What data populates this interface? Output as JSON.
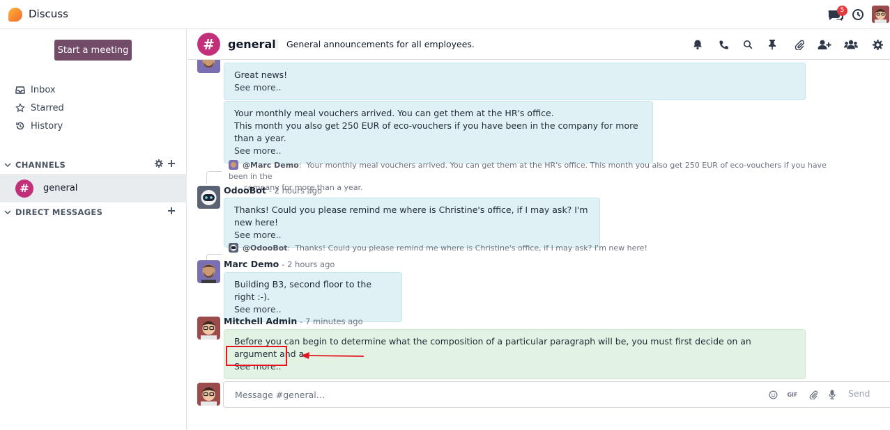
{
  "app": {
    "title": "Discuss",
    "notification_count": "5"
  },
  "sidebar": {
    "start_meeting_label": "Start a meeting",
    "nav": [
      {
        "label": "Inbox",
        "icon": "inbox-icon"
      },
      {
        "label": "Starred",
        "icon": "star-icon"
      },
      {
        "label": "History",
        "icon": "history-icon"
      }
    ],
    "channels_header": "CHANNELS",
    "channel": {
      "name": "general",
      "icon_glyph": "#"
    },
    "dm_header": "DIRECT MESSAGES"
  },
  "channel_header": {
    "glyph": "#",
    "name": "general",
    "description": "General announcements for all employees."
  },
  "messages": {
    "m1": {
      "lines": [
        "Great news!"
      ],
      "see_more": "See more.."
    },
    "m2": {
      "lines": [
        "Your monthly meal vouchers arrived. You can get them at the HR's office.",
        "This month you also get 250 EUR of eco-vouchers if you have been in the company for more than a year."
      ],
      "see_more": "See more.."
    },
    "reply1": {
      "who": "@Marc Demo",
      "text": "Your monthly meal vouchers arrived. You can get them at the HR's office. This month you also get 250 EUR of eco-vouchers if you have been in the",
      "text2": "company for more than a year."
    },
    "m3": {
      "author": "OdooBot",
      "time": "- 2 hours ago",
      "lines": [
        "Thanks! Could you please remind me where is Christine's office, if I may ask? I'm new here!"
      ],
      "see_more": "See more.."
    },
    "reply2": {
      "who": "@OdooBot",
      "text": "Thanks! Could you please remind me where is Christine's office, if I may ask? I'm new here!"
    },
    "m4": {
      "author": "Marc Demo",
      "time": "- 2 hours ago",
      "lines": [
        "Building B3, second floor to the right :-)."
      ],
      "see_more": "See more.."
    },
    "m5": {
      "author": "Mitchell Admin",
      "time": "- 7 minutes ago",
      "lines": [
        "Before you can begin to determine what the composition of a particular paragraph will be, you must first decide on an argument and a"
      ],
      "see_more": "See more.."
    }
  },
  "composer": {
    "placeholder": "Message #general…",
    "send_label": "Send",
    "gif_label": "GIF"
  },
  "colors": {
    "brand": "#714b67",
    "channel": "#c2307a",
    "bubble": "#e0f1f6",
    "own_bubble": "#e3f3e3",
    "highlight": "#e3161f"
  }
}
